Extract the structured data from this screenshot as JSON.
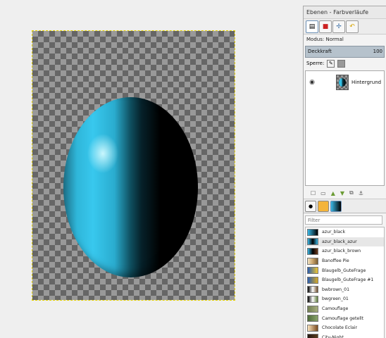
{
  "dock": {
    "title": "Ebenen - Farbverläufe",
    "mode_label": "Modus:",
    "mode_value": "Normal",
    "opacity_label": "Deckkraft",
    "opacity_value": "100",
    "lock_label": "Sperre:",
    "layer": {
      "name": "Hintergrund"
    },
    "filter_placeholder": "Filter"
  },
  "icons": {
    "dock_tabs": [
      "layers-icon",
      "channels-icon",
      "paths-icon",
      "undo-history-icon"
    ],
    "layer_actions": [
      "new-layer-icon",
      "new-layer-group-icon",
      "raise-layer-icon",
      "lower-layer-icon",
      "duplicate-layer-icon",
      "anchor-icon"
    ],
    "gradient_tabs": [
      "brushes-icon",
      "patterns-icon",
      "gradients-icon"
    ]
  },
  "gradients": [
    {
      "name": "azur_black",
      "colors": [
        "#39b8e6",
        "#000000"
      ]
    },
    {
      "name": "azur_black_azur",
      "colors": [
        "#39b8e6",
        "#000000",
        "#39b8e6"
      ]
    },
    {
      "name": "azur_black_brown",
      "colors": [
        "#39b8e6",
        "#000000",
        "#6b3a1e"
      ]
    },
    {
      "name": "Banoffee Pie",
      "colors": [
        "#f1e3c2",
        "#c9a36b",
        "#7a5d31"
      ]
    },
    {
      "name": "Blaugelb_GuteFrage",
      "colors": [
        "#2a5db0",
        "#f0c62f"
      ]
    },
    {
      "name": "Blaugelb_GuteFrage #1",
      "colors": [
        "#2a5db0",
        "#d8aa24"
      ]
    },
    {
      "name": "bwbrown_01",
      "colors": [
        "#000000",
        "#ffffff",
        "#6b4b2a"
      ]
    },
    {
      "name": "bwgreen_01",
      "colors": [
        "#000000",
        "#ffffff",
        "#5c7a3a"
      ]
    },
    {
      "name": "Camouflage",
      "colors": [
        "#6f7d52",
        "#a7ae7d"
      ]
    },
    {
      "name": "Camouflage getellt",
      "colors": [
        "#4e6a3a",
        "#89a36a"
      ]
    },
    {
      "name": "Chocolate Eclair",
      "colors": [
        "#fbe4bd",
        "#7a4a20"
      ]
    },
    {
      "name": "City-Night",
      "colors": [
        "#241812",
        "#5b3c1e"
      ]
    }
  ]
}
